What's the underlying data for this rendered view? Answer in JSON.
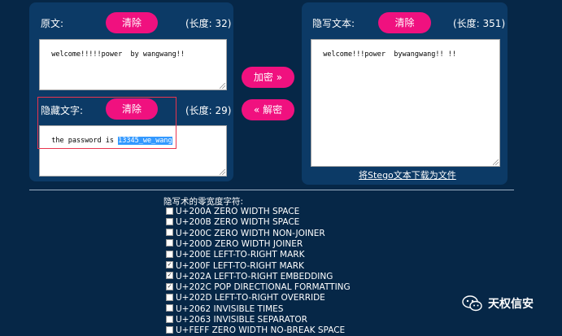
{
  "original": {
    "label": "原文:",
    "clear_label": "清除",
    "length_label": "(长度: 32)",
    "value": "welcome!!!!!power  by wangwang!!"
  },
  "hidden": {
    "label": "隐藏文字:",
    "clear_label": "清除",
    "length_label": "(长度: 29)",
    "value_plain": "the password is ",
    "value_selected": "13345_we_wang"
  },
  "stego": {
    "label": "隐写文本:",
    "clear_label": "清除",
    "length_label": "(长度: 351)",
    "value": "welcome!!!power  bywangwang!! !!",
    "download_label": "将Stego文本下载为文件"
  },
  "actions": {
    "encrypt_label": "加密 »",
    "decrypt_label": "« 解密"
  },
  "config": {
    "title": "隐写术的零宽度字符:",
    "options": [
      {
        "label": "U+200A ZERO WIDTH SPACE",
        "checked": false
      },
      {
        "label": "U+200B ZERO WIDTH SPACE",
        "checked": false
      },
      {
        "label": "U+200C ZERO WIDTH NON-JOINER",
        "checked": false
      },
      {
        "label": "U+200D ZERO WIDTH JOINER",
        "checked": false
      },
      {
        "label": "U+200E LEFT-TO-RIGHT MARK",
        "checked": false
      },
      {
        "label": "U+200F LEFT-TO-RIGHT MARK",
        "checked": true
      },
      {
        "label": "U+202A LEFT-TO-RIGHT EMBEDDING",
        "checked": true
      },
      {
        "label": "U+202C POP DIRECTIONAL FORMATTING",
        "checked": true
      },
      {
        "label": "U+202D LEFT-TO-RIGHT OVERRIDE",
        "checked": false
      },
      {
        "label": "U+2062 INVISIBLE TIMES",
        "checked": false
      },
      {
        "label": "U+2063 INVISIBLE SEPARATOR",
        "checked": false
      },
      {
        "label": "U+FEFF ZERO WIDTH NO-BREAK SPACE",
        "checked": false
      }
    ]
  },
  "watermark": {
    "text": "天权信安",
    "icon": "wechat-icon"
  },
  "colors": {
    "background": "#062747",
    "panel": "#0c3a66",
    "accent": "#f0117f",
    "highlight_box": "#e8344e"
  }
}
